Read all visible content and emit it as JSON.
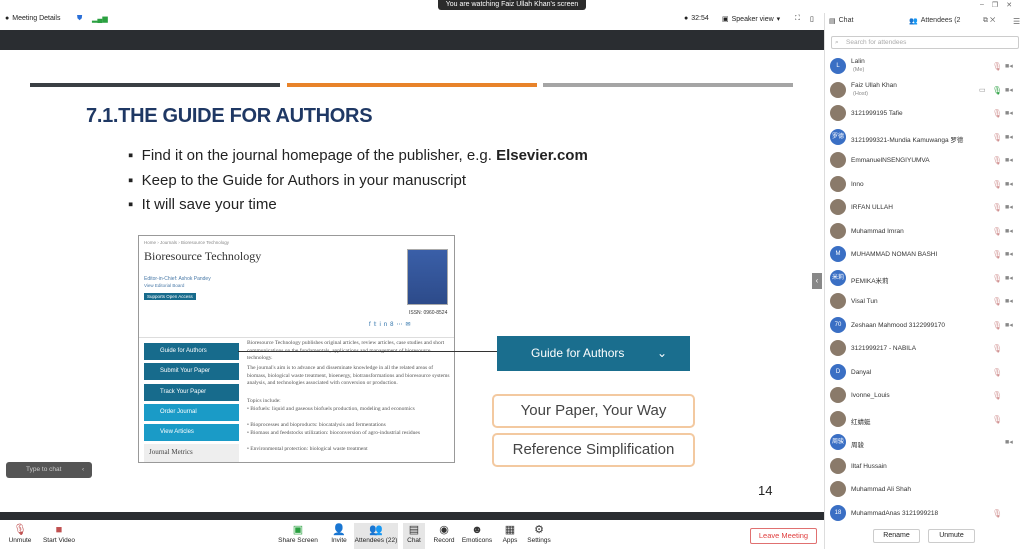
{
  "banner": "You are watching Faiz Ullah Khan's screen",
  "topbar": {
    "meeting_details": "Meeting Details",
    "timer": "32:54",
    "view": "Speaker view"
  },
  "panel": {
    "chat_tab": "Chat",
    "attendees_tab": "Attendees (2",
    "search_placeholder": "Search for attendees",
    "rename": "Rename",
    "unmute": "Unmute"
  },
  "attendees": [
    {
      "name": "Lalin",
      "sub": "(Me)",
      "initial": "L",
      "mic": true,
      "cam": true
    },
    {
      "name": "Faiz Ullah Khan",
      "sub": "(Host)",
      "initial": "",
      "mic": true,
      "cam": true,
      "speaking": true
    },
    {
      "name": "3121999195 Tafie",
      "initial": "",
      "mic": true,
      "cam": true
    },
    {
      "name": "3121999321-Mundia Kamuwanga 罗德",
      "initial": "罗德",
      "mic": true,
      "cam": true
    },
    {
      "name": "EmmanuelNSENGIYUMVA",
      "initial": "",
      "mic": true,
      "cam": true
    },
    {
      "name": "Inno",
      "initial": "",
      "mic": true,
      "cam": true
    },
    {
      "name": "IRFAN ULLAH",
      "initial": "",
      "mic": true,
      "cam": true
    },
    {
      "name": "Muhammad Imran",
      "initial": "",
      "mic": true,
      "cam": true
    },
    {
      "name": "MUHAMMAD NOMAN BASHI",
      "initial": "M",
      "mic": true,
      "cam": true
    },
    {
      "name": "PEMIKA米莉",
      "initial": "米莉",
      "mic": true,
      "cam": true
    },
    {
      "name": "Visal Tun",
      "initial": "",
      "mic": true,
      "cam": true
    },
    {
      "name": "Zeshaan Mahmood 3122999170",
      "initial": "70",
      "mic": true,
      "cam": true
    },
    {
      "name": "3121999217 - NABILA",
      "initial": "",
      "mic": true,
      "cam": false
    },
    {
      "name": "Danyal",
      "initial": "D",
      "mic": true,
      "cam": false
    },
    {
      "name": "Ivonne_Louis",
      "initial": "",
      "mic": true,
      "cam": false
    },
    {
      "name": "红蜻蜓",
      "initial": "",
      "mic": true,
      "cam": false
    },
    {
      "name": "周骏",
      "initial": "周骏",
      "mic": false,
      "cam": true
    },
    {
      "name": "Iltaf Hussain",
      "initial": "",
      "mic": false,
      "cam": false
    },
    {
      "name": "Muhammad Ali Shah",
      "initial": "",
      "mic": false,
      "cam": false
    },
    {
      "name": "MuhammadAnas 3121999218",
      "initial": "18",
      "mic": true,
      "cam": false
    }
  ],
  "slide": {
    "title": "7.1.THE GUIDE FOR AUTHORS",
    "bullets": [
      "Find it on the journal homepage of the publisher, e.g. ",
      "Keep to the Guide for Authors in your manuscript",
      "It will save your time"
    ],
    "bullet_bold": "Elsevier.com",
    "page_number": "14",
    "guide_box": "Guide for Authors",
    "box1": "Your Paper, Your Way",
    "box2": "Reference Simplification",
    "colors": {
      "title": "#1f3864",
      "bar1": "#3a3f44",
      "bar2": "#e8832a",
      "bar3": "#a5a5a5",
      "guide": "#1a6e8e"
    },
    "web": {
      "breadcrumb": "Home › Journals › Bioresource Technology",
      "journal": "Bioresource Technology",
      "editor": "Editor-in-Chief: Ashok Pandey",
      "board": "View Editorial Board",
      "open_access": "Supports Open Access",
      "issn": "ISSN: 0960-8524",
      "nav": [
        "Guide for Authors",
        "Submit Your Paper",
        "Track Your Paper",
        "Order Journal",
        "View Articles"
      ],
      "metrics": "Journal Metrics",
      "paras": [
        "Bioresource Technology publishes original articles, review articles, case studies and short communications on the fundamentals, applications and management of bioresource technology.",
        "The journal's aim is to advance and disseminate knowledge in all the related areas of biomass, biological waste treatment, bioenergy, biotransformations and bioresource systems analysis, and technologies associated with conversion or production.",
        "Topics include:",
        "• Biofuels: liquid and gaseous biofuels production, modeling and economics",
        "• Bioprocesses and bioproducts: biocatalysis and fermentations",
        "• Biomass and feedstocks utilization: bioconversion of agro-industrial residues",
        "• Environmental protection: biological waste treatment"
      ]
    }
  },
  "chat_input_placeholder": "Type to chat",
  "toolbar": {
    "unmute": "Unmute",
    "start_video": "Start Video",
    "share_screen": "Share Screen",
    "invite": "Invite",
    "attendees": "Attendees (22)",
    "chat": "Chat",
    "record": "Record",
    "emoticons": "Emoticons",
    "apps": "Apps",
    "settings": "Settings",
    "leave": "Leave Meeting"
  }
}
